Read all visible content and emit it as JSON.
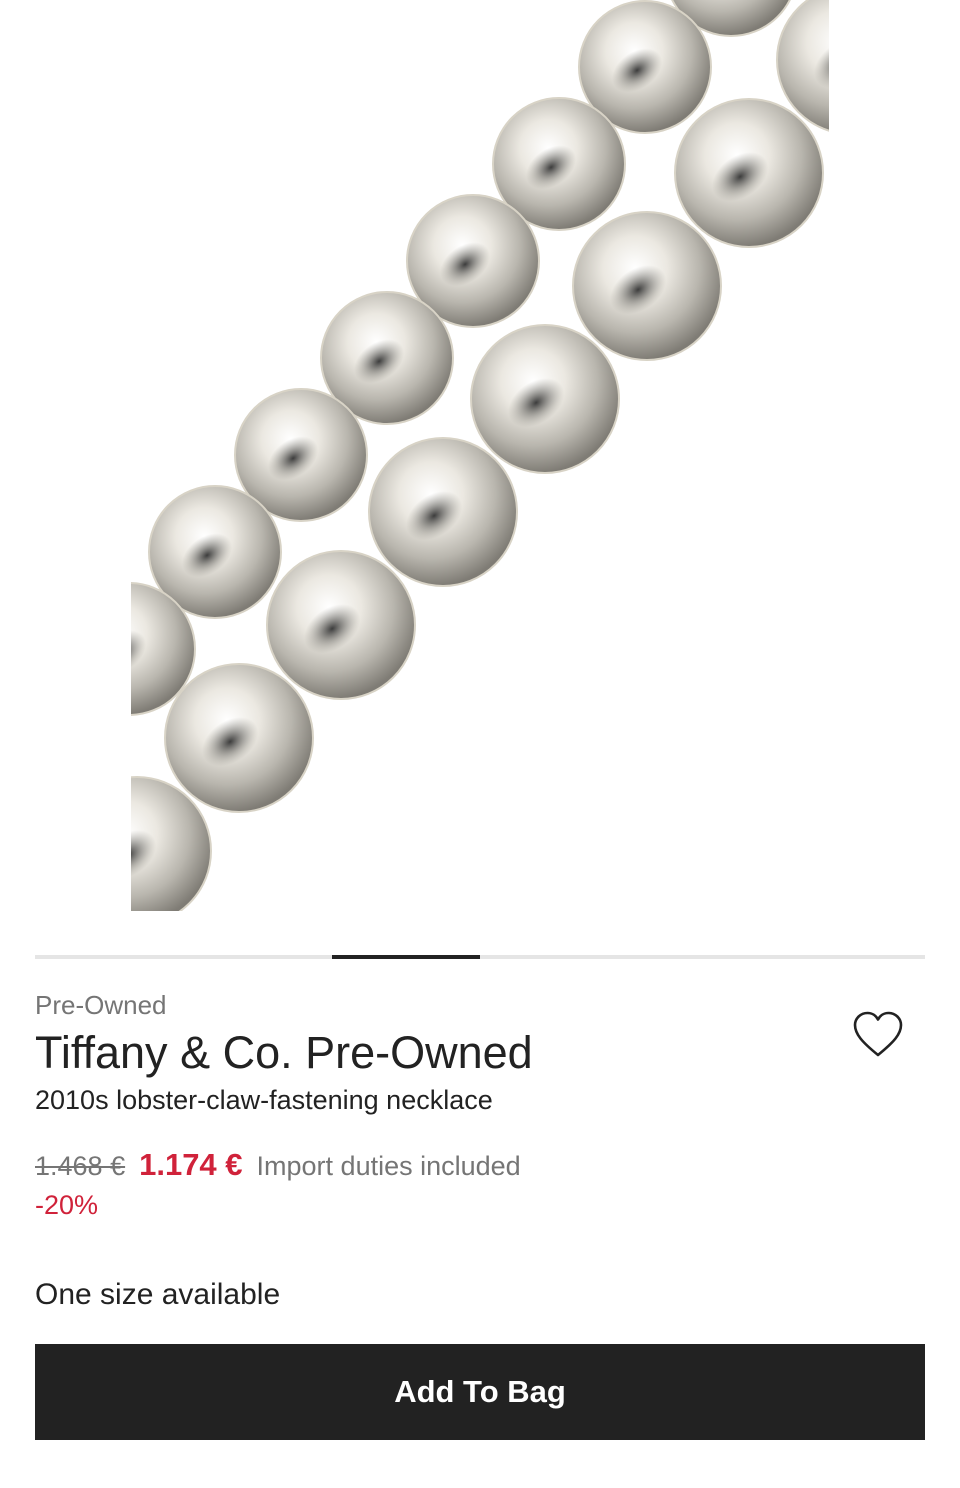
{
  "product": {
    "condition": "Pre-Owned",
    "brand": "Tiffany & Co. Pre-Owned",
    "description": "2010s lobster-claw-fastening necklace",
    "image_alt": "silver bead necklace"
  },
  "gallery": {
    "slides": 6,
    "active_index": 2
  },
  "price": {
    "original": "1.468 €",
    "current": "1.174 €",
    "duties_note": "Import duties included",
    "discount": "-20%"
  },
  "sizes": {
    "label": "One size available"
  },
  "actions": {
    "add_to_bag": "Add To Bag"
  },
  "colors": {
    "accent_sale": "#d0223a",
    "button_bg": "#222222",
    "muted_text": "#757575"
  }
}
